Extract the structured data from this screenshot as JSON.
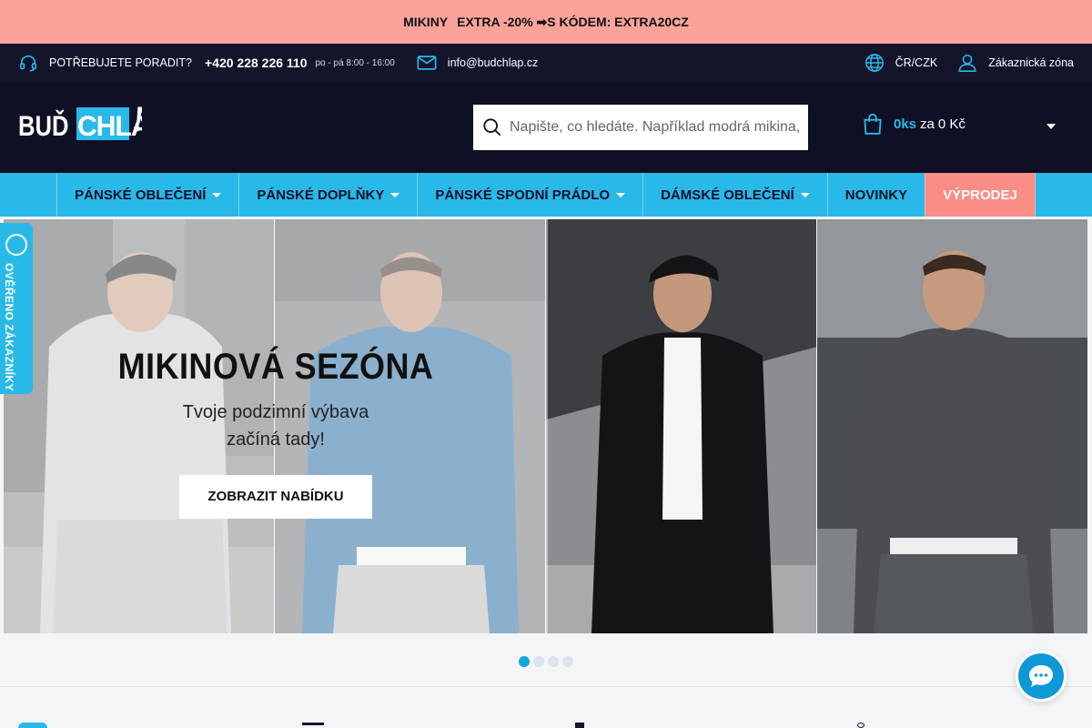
{
  "promo": {
    "part1": "MIKINY",
    "part2": "EXTRA -20% ➡S KÓDEM: EXTRA20CZ"
  },
  "topbar": {
    "help_label": "POTŘEBUJETE PORADIT?",
    "phone": "+420 228 226 110",
    "hours": "po - pá 8:00 - 16:00",
    "email": "info@budchlap.cz",
    "region": "ČR/CZK",
    "account_label": "Zákaznická zóna"
  },
  "header": {
    "logo_text": "BUĎ CHLAP!",
    "search_placeholder": "Napište, co hledáte. Například modrá mikina,",
    "cart_qty": "0ks",
    "cart_price_prefix": "za",
    "cart_price": "0 Kč"
  },
  "nav": {
    "items": [
      {
        "label": "PÁNSKÉ OBLEČENÍ"
      },
      {
        "label": "PÁNSKÉ DOPLŇKY"
      },
      {
        "label": "PÁNSKÉ SPODNÍ PRÁDLO"
      },
      {
        "label": "DÁMSKÉ OBLEČENÍ"
      },
      {
        "label": "NOVINKY"
      },
      {
        "label": "VÝPRODEJ"
      }
    ]
  },
  "hero": {
    "title": "MIKINOVÁ SEZÓNA",
    "subtitle_line1": "Tvoje podzimní výbava",
    "subtitle_line2": "začíná tady!",
    "cta": "ZOBRAZIT NABÍDKU",
    "slide_count": 4,
    "active_slide": 1
  },
  "badge": {
    "text": "OVĚŘENO ZÁKAZNÍKY"
  },
  "colors": {
    "promo_bg": "#fba39a",
    "dark_bg": "#0f0f26",
    "accent": "#29b9e8",
    "sale": "#fa8d86"
  }
}
